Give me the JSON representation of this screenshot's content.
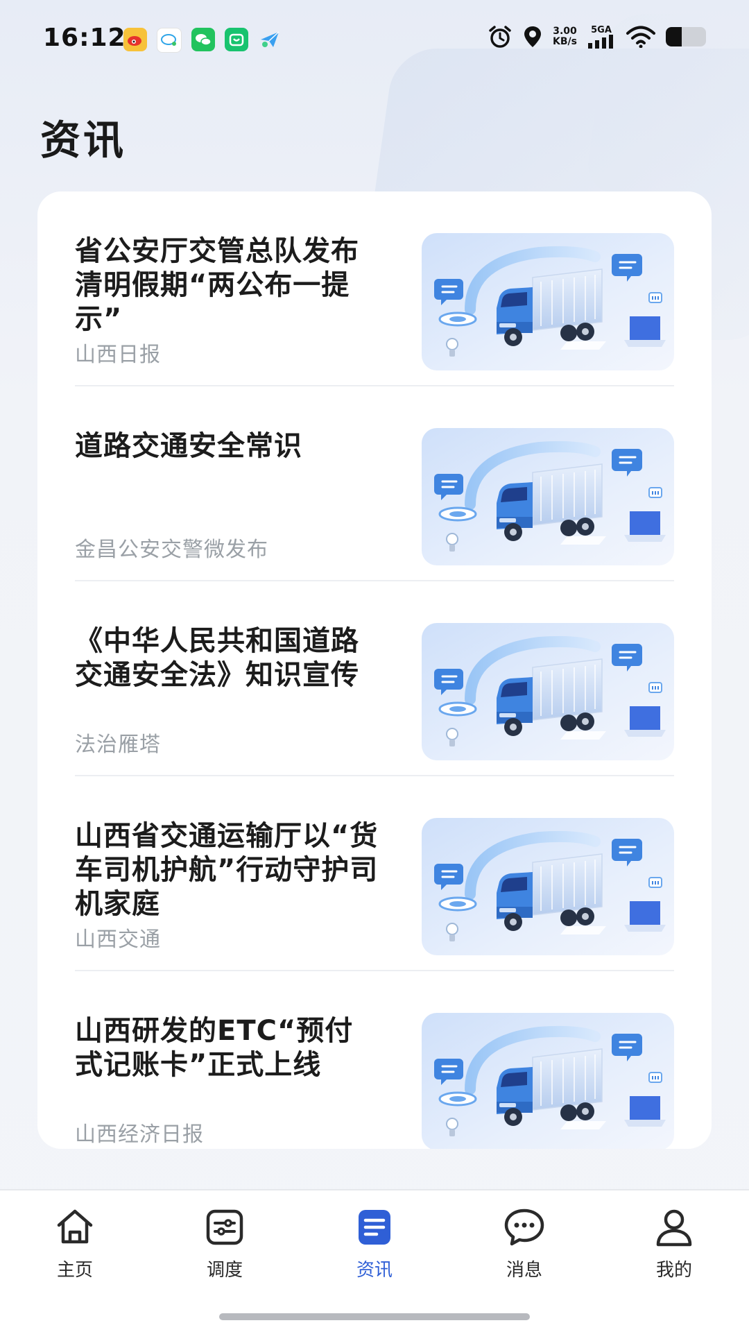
{
  "status_bar": {
    "time": "16:12",
    "net_speed_value": "3.00",
    "net_speed_unit": "KB/s",
    "signal_label": "5GA",
    "icons": [
      "weibo-icon",
      "bubble-icon",
      "wechat-icon",
      "shopping-icon",
      "send-icon",
      "alarm-icon",
      "location-icon",
      "signal-icon",
      "wifi-icon",
      "battery-icon"
    ],
    "battery_level": 0.4
  },
  "page": {
    "title": "资讯"
  },
  "news": [
    {
      "title": "省公安厅交管总队发布清明假期“两公布一提示”",
      "source": "山西日报"
    },
    {
      "title": "道路交通安全常识",
      "source": "金昌公安交警微发布"
    },
    {
      "title": "《中华人民共和国道路交通安全法》知识宣传",
      "source": "法治雁塔"
    },
    {
      "title": "山西省交通运输厅以“货车司机护航”行动守护司机家庭",
      "source": "山西交通"
    },
    {
      "title": "山西研发的ETC“预付式记账卡”正式上线",
      "source": "山西经济日报"
    }
  ],
  "nav": {
    "items": [
      {
        "label": "主页",
        "icon": "home-icon",
        "active": false
      },
      {
        "label": "调度",
        "icon": "dispatch-icon",
        "active": false
      },
      {
        "label": "资讯",
        "icon": "news-icon",
        "active": true
      },
      {
        "label": "消息",
        "icon": "message-icon",
        "active": false
      },
      {
        "label": "我的",
        "icon": "profile-icon",
        "active": false
      }
    ]
  },
  "colors": {
    "accent": "#2f5fd6",
    "title_text": "#1c1c1c",
    "source_text": "#9aa0a6",
    "truck_blue": "#3f84e0"
  }
}
